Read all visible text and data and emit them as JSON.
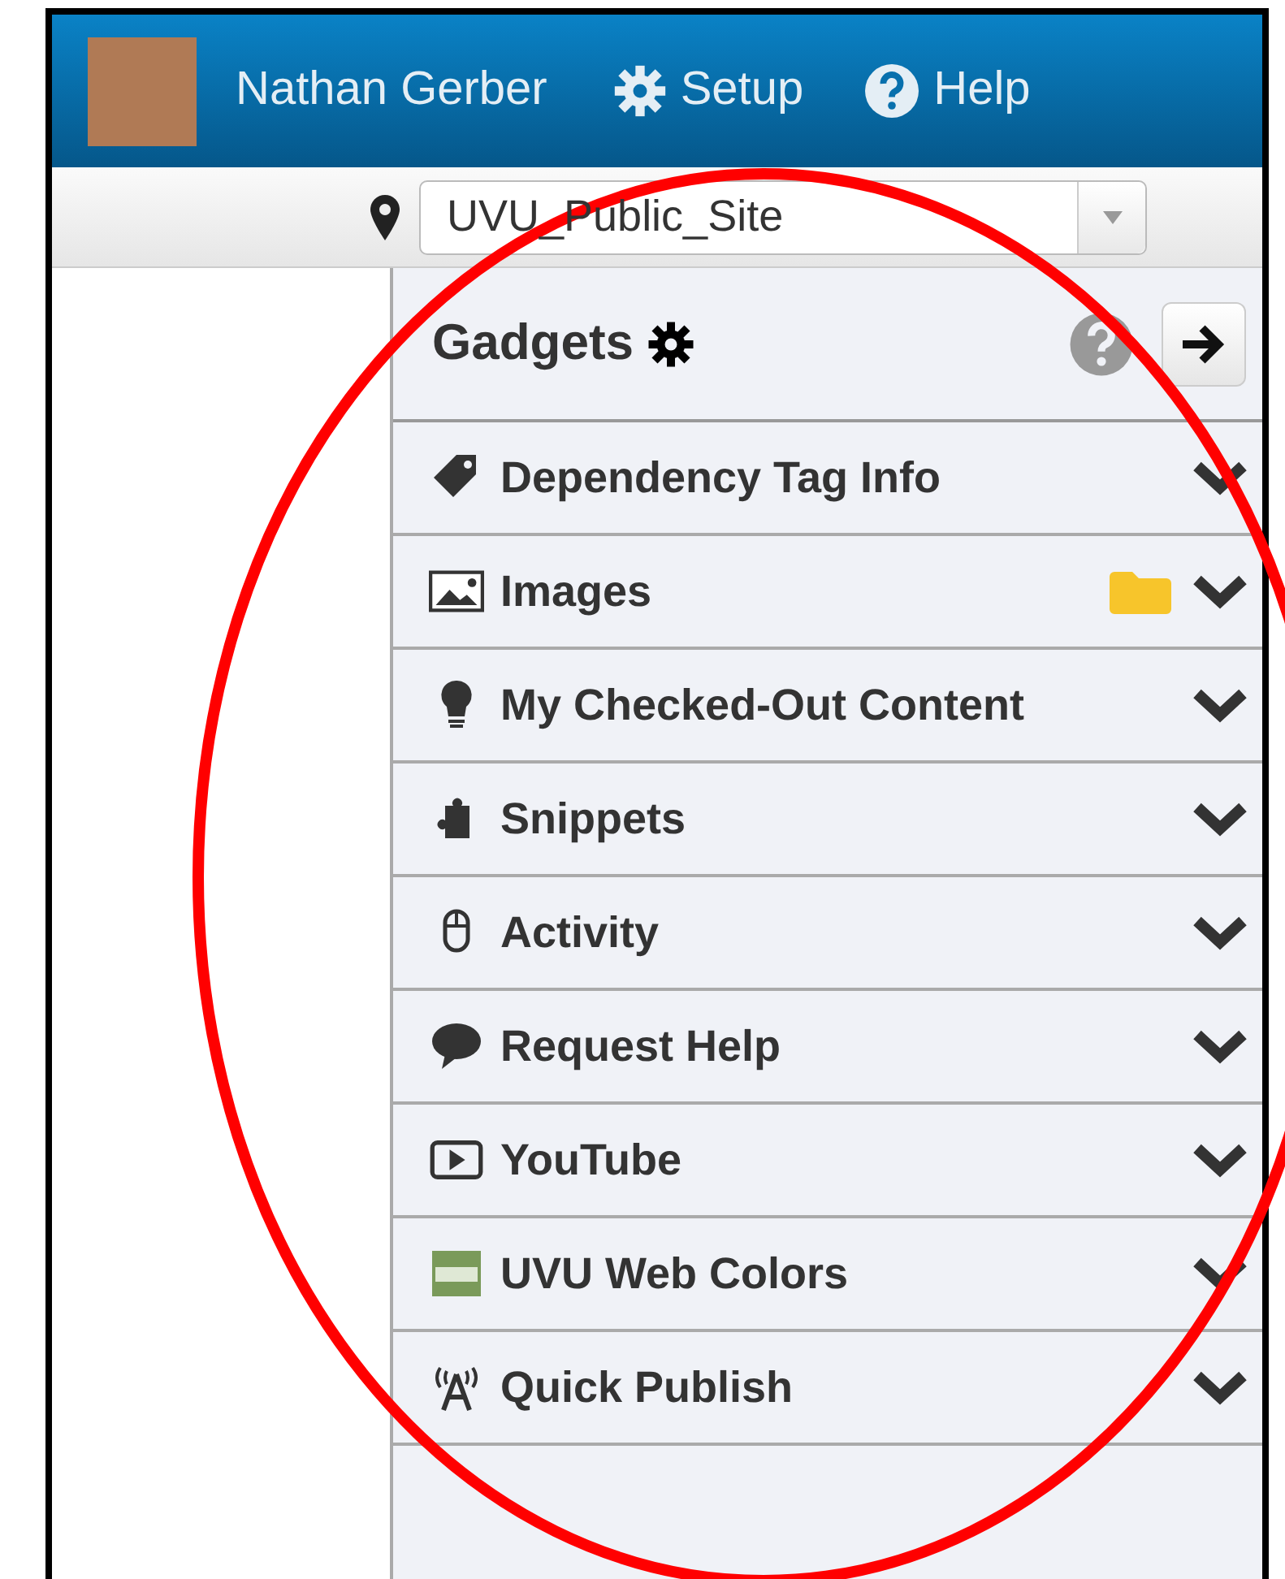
{
  "header": {
    "user_name": "Nathan Gerber",
    "links": [
      "Setup",
      "Help"
    ]
  },
  "site_selector": {
    "value": "UVU_Public_Site"
  },
  "gadgets_panel": {
    "title": "Gadgets",
    "items": [
      {
        "label": "Dependency Tag Info",
        "folder": false
      },
      {
        "label": "Images",
        "folder": true
      },
      {
        "label": "My Checked-Out Content",
        "folder": false
      },
      {
        "label": "Snippets",
        "folder": false
      },
      {
        "label": "Activity",
        "folder": false
      },
      {
        "label": "Request Help",
        "folder": false
      },
      {
        "label": "YouTube",
        "folder": false
      },
      {
        "label": "UVU Web Colors",
        "folder": false
      },
      {
        "label": "Quick Publish",
        "folder": false
      }
    ]
  }
}
